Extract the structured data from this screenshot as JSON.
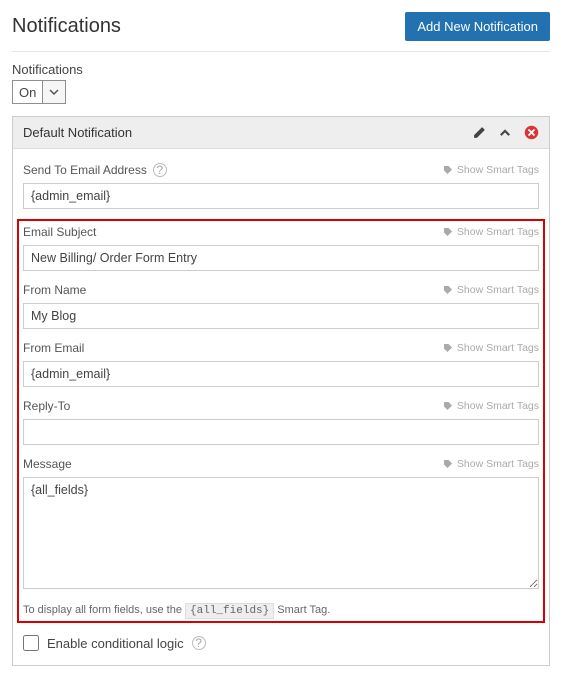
{
  "header": {
    "title": "Notifications",
    "add_button": "Add New Notification"
  },
  "status": {
    "label": "Notifications",
    "value": "On"
  },
  "panel": {
    "title": "Default Notification"
  },
  "smart": "Show Smart Tags",
  "fields": {
    "send_to": {
      "label": "Send To Email Address",
      "value": "{admin_email}"
    },
    "subject": {
      "label": "Email Subject",
      "value": "New Billing/ Order Form Entry"
    },
    "from_name": {
      "label": "From Name",
      "value": "My Blog"
    },
    "from_email": {
      "label": "From Email",
      "value": "{admin_email}"
    },
    "reply_to": {
      "label": "Reply-To",
      "value": ""
    },
    "message": {
      "label": "Message",
      "value": "{all_fields}"
    }
  },
  "hint": {
    "pre": "To display all form fields, use the ",
    "code": "{all_fields}",
    "post": " Smart Tag."
  },
  "conditional": {
    "label": "Enable conditional logic"
  }
}
